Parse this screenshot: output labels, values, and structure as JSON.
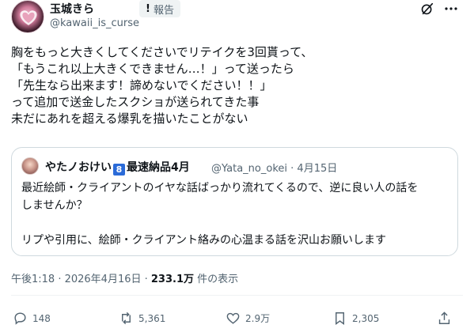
{
  "author": {
    "name": "玉城きら",
    "handle": "@kawaii_is_curse",
    "report_label": "報告",
    "report_icon": "!"
  },
  "post": {
    "lines": [
      "胸をもっと大きくしてくださいでリテイクを3回貰って、",
      "「もうこれ以上大きくできません…！」って送ったら",
      "「先生なら出来ます！諦めないでください！！」",
      "って追加で送金したスクショが送られてきた事",
      "未だにあれを超える爆乳を描いたことがない"
    ]
  },
  "quote": {
    "name_prefix": "やたノおけい",
    "badge": "8",
    "name_suffix": "最速納品4月",
    "handle": "@Yata_no_okei",
    "date": "· 4月15日",
    "lines": [
      "最近絵師・クライアントのイヤな話ばっかり流れてくるので、逆に良い人の話を",
      "しませんか？",
      "",
      "リプや引用に、絵師・クライアント絡みの心温まる話を沢山お願いします"
    ]
  },
  "meta": {
    "time": "午後1:18 · 2026年4月16日 · ",
    "views": "233.1万",
    "views_suffix": " 件の表示"
  },
  "actions": {
    "replies": "148",
    "reposts": "5,361",
    "likes": "2.9万",
    "bookmarks": "2,305"
  },
  "icons": [
    "grok-icon",
    "more-icon",
    "reply-icon",
    "repost-icon",
    "like-icon",
    "bookmark-icon",
    "share-icon"
  ]
}
